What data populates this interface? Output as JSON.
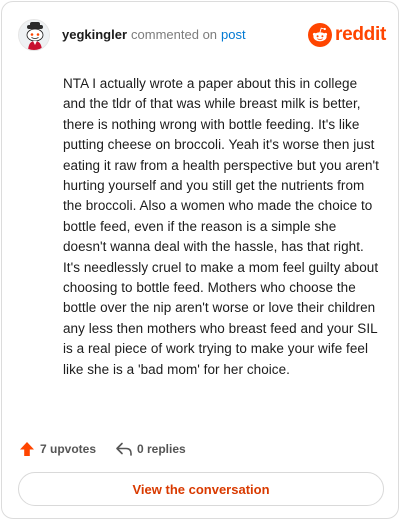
{
  "header": {
    "username": "yegkingler",
    "action_text": "commented on",
    "post_link": "post",
    "brand_word": "reddit",
    "avatar_icon": "snoo-avatar-icon",
    "brand_icon": "reddit-logo-icon"
  },
  "comment": {
    "text": "NTA I actually wrote a paper about this in college and the tldr of that was while breast milk is better, there is nothing wrong with bottle feeding. It's like putting cheese on broccoli. Yeah it's worse then just eating it raw from a health perspective but you aren't hurting yourself and you still get the nutrients from the broccoli. Also a women who made the choice to bottle feed, even if the reason is a simple she doesn't wanna deal with the hassle, has that right. It's needlessly cruel to make a mom feel guilty about choosing to bottle feed. Mothers who choose the bottle over the nip aren't worse or love their children any less then mothers who breast feed and your SIL is a real piece of work trying to make your wife feel like she is a 'bad mom' for her choice."
  },
  "actions": {
    "upvotes_label": "7 upvotes",
    "replies_label": "0 replies",
    "upvote_icon": "upvote-arrow-icon",
    "reply_icon": "reply-arrow-icon"
  },
  "cta": {
    "label": "View the conversation"
  },
  "colors": {
    "brand": "#ff4500",
    "link": "#0079d3",
    "cta_text": "#d93a00",
    "muted": "#7c7c7c"
  }
}
